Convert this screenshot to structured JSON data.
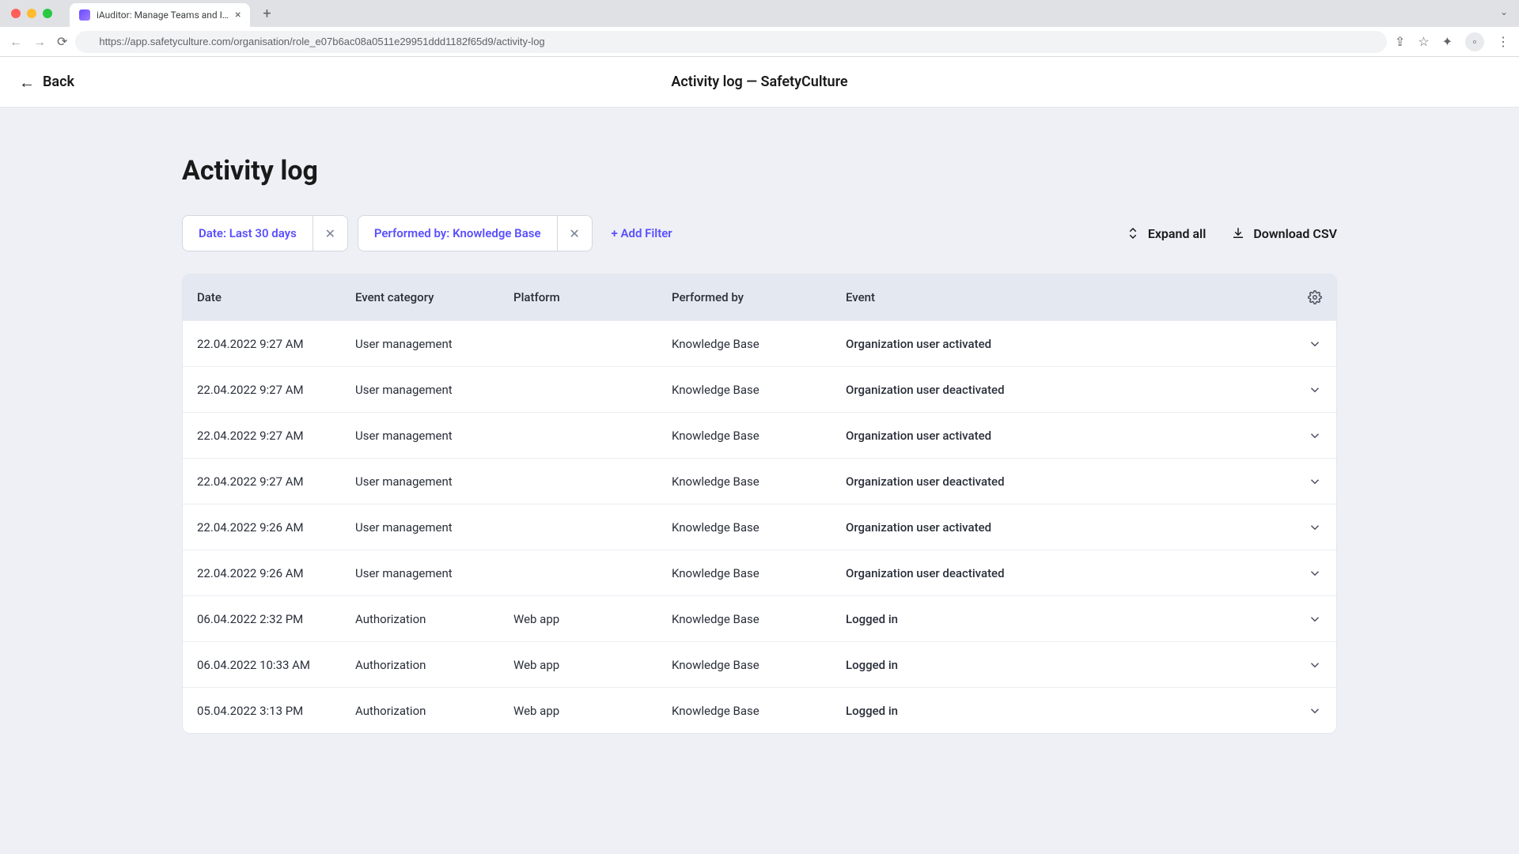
{
  "browser": {
    "tab_title": "iAuditor: Manage Teams and I…",
    "url": "https://app.safetyculture.com/organisation/role_e07b6ac08a0511e29951ddd1182f65d9/activity-log"
  },
  "header": {
    "back_label": "Back",
    "page_title": "Activity log — SafetyCulture"
  },
  "page": {
    "title": "Activity log"
  },
  "filters": [
    {
      "label": "Date: Last 30 days"
    },
    {
      "label": "Performed by: Knowledge Base"
    }
  ],
  "add_filter_label": "+ Add Filter",
  "actions": {
    "expand_all": "Expand all",
    "download_csv": "Download CSV"
  },
  "columns": {
    "date": "Date",
    "category": "Event category",
    "platform": "Platform",
    "performed_by": "Performed by",
    "event": "Event"
  },
  "rows": [
    {
      "date": "22.04.2022 9:27 AM",
      "category": "User management",
      "platform": "",
      "performed_by": "Knowledge Base",
      "event": "Organization user activated"
    },
    {
      "date": "22.04.2022 9:27 AM",
      "category": "User management",
      "platform": "",
      "performed_by": "Knowledge Base",
      "event": "Organization user deactivated"
    },
    {
      "date": "22.04.2022 9:27 AM",
      "category": "User management",
      "platform": "",
      "performed_by": "Knowledge Base",
      "event": "Organization user activated"
    },
    {
      "date": "22.04.2022 9:27 AM",
      "category": "User management",
      "platform": "",
      "performed_by": "Knowledge Base",
      "event": "Organization user deactivated"
    },
    {
      "date": "22.04.2022 9:26 AM",
      "category": "User management",
      "platform": "",
      "performed_by": "Knowledge Base",
      "event": "Organization user activated"
    },
    {
      "date": "22.04.2022 9:26 AM",
      "category": "User management",
      "platform": "",
      "performed_by": "Knowledge Base",
      "event": "Organization user deactivated"
    },
    {
      "date": "06.04.2022 2:32 PM",
      "category": "Authorization",
      "platform": "Web app",
      "performed_by": "Knowledge Base",
      "event": "Logged in"
    },
    {
      "date": "06.04.2022 10:33 AM",
      "category": "Authorization",
      "platform": "Web app",
      "performed_by": "Knowledge Base",
      "event": "Logged in"
    },
    {
      "date": "05.04.2022 3:13 PM",
      "category": "Authorization",
      "platform": "Web app",
      "performed_by": "Knowledge Base",
      "event": "Logged in"
    }
  ]
}
